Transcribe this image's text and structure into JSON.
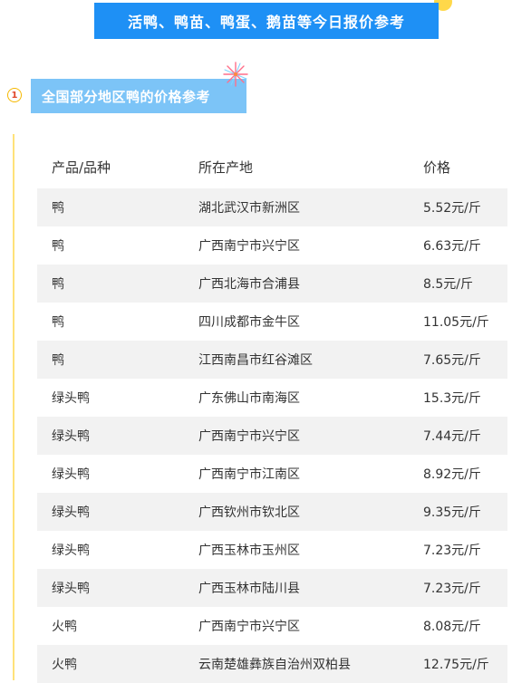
{
  "banner": {
    "title": "活鸭、鸭苗、鸭蛋、鹅苗等今日报价参考"
  },
  "section": {
    "number": "1",
    "title": "全国部分地区鸭的价格参考"
  },
  "table": {
    "headers": [
      "产品/品种",
      "所在产地",
      "价格"
    ],
    "rows": [
      [
        "鸭",
        "湖北武汉市新洲区",
        "5.52元/斤"
      ],
      [
        "鸭",
        "广西南宁市兴宁区",
        "6.63元/斤"
      ],
      [
        "鸭",
        "广西北海市合浦县",
        "8.5元/斤"
      ],
      [
        "鸭",
        "四川成都市金牛区",
        "11.05元/斤"
      ],
      [
        "鸭",
        "江西南昌市红谷滩区",
        "7.65元/斤"
      ],
      [
        "绿头鸭",
        "广东佛山市南海区",
        "15.3元/斤"
      ],
      [
        "绿头鸭",
        "广西南宁市兴宁区",
        "7.44元/斤"
      ],
      [
        "绿头鸭",
        "广西南宁市江南区",
        "8.92元/斤"
      ],
      [
        "绿头鸭",
        "广西钦州市钦北区",
        "9.35元/斤"
      ],
      [
        "绿头鸭",
        "广西玉林市玉州区",
        "7.23元/斤"
      ],
      [
        "绿头鸭",
        "广西玉林市陆川县",
        "7.23元/斤"
      ],
      [
        "火鸭",
        "广西南宁市兴宁区",
        "8.08元/斤"
      ],
      [
        "火鸭",
        "云南楚雄彝族自治州双柏县",
        "12.75元/斤"
      ]
    ]
  },
  "colors": {
    "banner_blue": "#1e90f5",
    "heading_blue": "#7cc4f7",
    "accent_yellow": "#ffd84a",
    "row_shade": "#f2f2f2",
    "number_red": "#e0472a"
  },
  "icons": [
    "firework-icon",
    "number-badge-circle"
  ]
}
